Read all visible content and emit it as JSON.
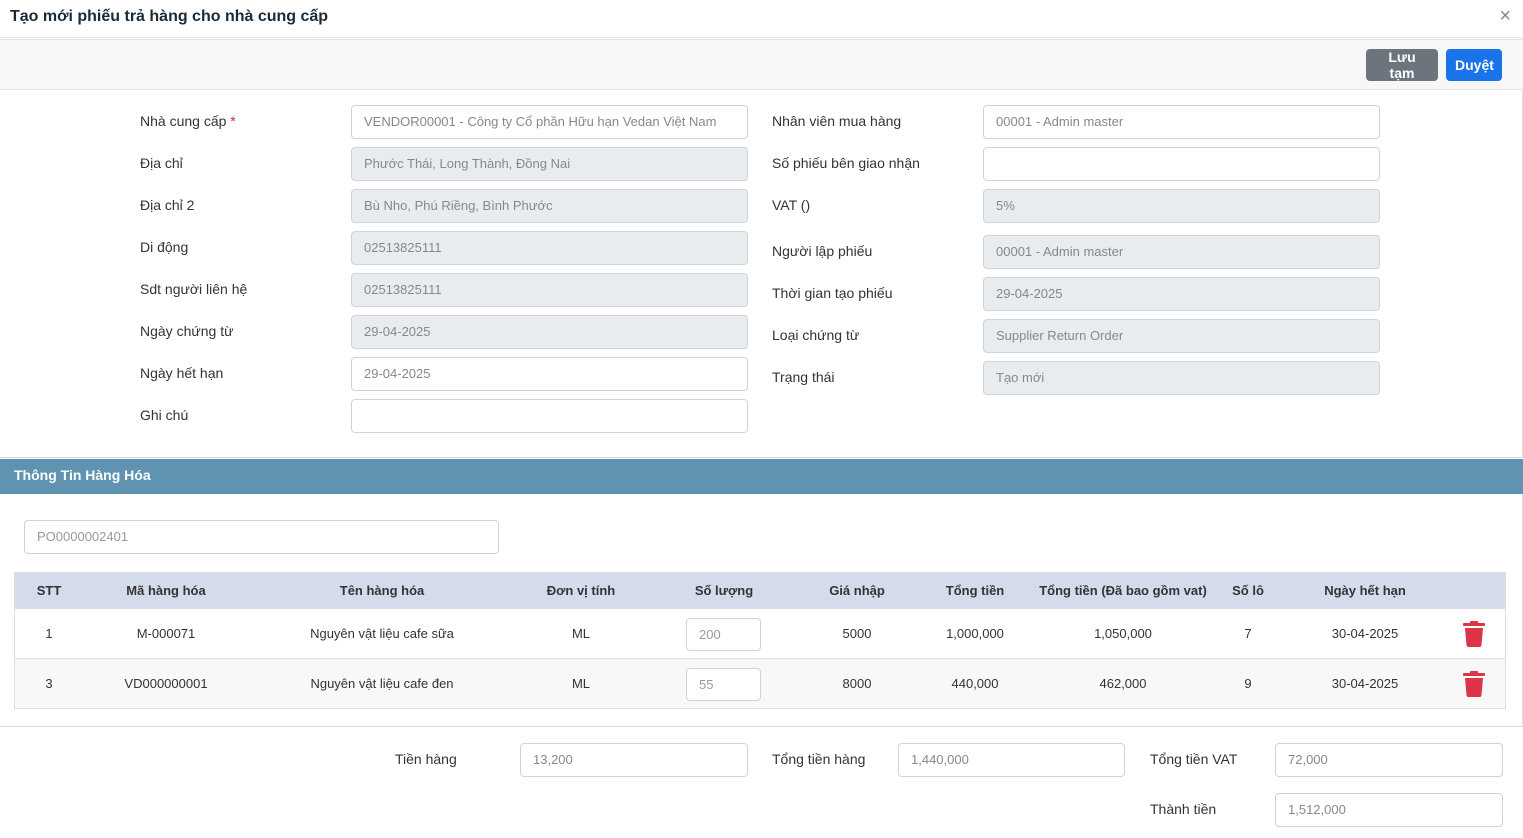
{
  "modal": {
    "title": "Tạo mới phiếu trả hàng cho nhà cung cấp",
    "close_icon": "×"
  },
  "toolbar": {
    "save_draft_label": "Lưu tạm",
    "approve_label": "Duyệt"
  },
  "form": {
    "left": [
      {
        "label": "Nhà cung cấp",
        "required": "*",
        "value": "VENDOR00001 - Công ty Cổ phần Hữu hạn Vedan Việt Nam"
      },
      {
        "label": "Địa chỉ",
        "value": "Phước Thái, Long Thành, Đồng Nai"
      },
      {
        "label": "Địa chỉ 2",
        "value": "Bù Nho, Phú Riềng, Bình Phước"
      },
      {
        "label": "Di động",
        "value": "02513825111"
      },
      {
        "label": "Sdt người liên hệ",
        "value": "02513825111"
      },
      {
        "label": "Ngày chứng từ",
        "value": "29-04-2025"
      },
      {
        "label": "Ngày hết hạn",
        "value": "29-04-2025"
      },
      {
        "label": "Ghi chú",
        "value": ""
      }
    ],
    "right": [
      {
        "label": "Nhân viên mua hàng",
        "value": "00001 - Admin master"
      },
      {
        "label": "Số phiếu bên giao nhận",
        "value": ""
      },
      {
        "label": "VAT ()",
        "value": "5%"
      },
      {
        "label": "Người lập phiếu",
        "value": "00001 - Admin master"
      },
      {
        "label": "Thời gian tạo phiếu",
        "value": "29-04-2025"
      },
      {
        "label": "Loại chứng từ",
        "value": "Supplier Return Order"
      },
      {
        "label": "Trạng thái",
        "value": "Tạo mới"
      }
    ]
  },
  "goods": {
    "section_title": "Thông Tin Hàng Hóa",
    "po_input_placeholder": "PO0000002401",
    "columns": [
      "STT",
      "Mã hàng hóa",
      "Tên hàng hóa",
      "Đơn vị tính",
      "Số lượng",
      "Giá nhập",
      "Tổng tiền",
      "Tổng tiền (Đã bao gồm vat)",
      "Số lô",
      "Ngày hết hạn"
    ],
    "rows": [
      {
        "stt": "1",
        "code": "M-000071",
        "name": "Nguyên vật liệu cafe sữa",
        "unit": "ML",
        "qty": "200",
        "price": "5000",
        "total": "1,000,000",
        "total_vat": "1,050,000",
        "lot": "7",
        "expiry": "30-04-2025"
      },
      {
        "stt": "3",
        "code": "VD000000001",
        "name": "Nguyên vật liệu cafe đen",
        "unit": "ML",
        "qty": "55",
        "price": "8000",
        "total": "440,000",
        "total_vat": "462,000",
        "lot": "9",
        "expiry": "30-04-2025"
      }
    ],
    "delete_icon": "trash-icon",
    "delete_color": "#dc3545"
  },
  "totals": {
    "goods_amount_label": "Tiền hàng",
    "goods_amount_value": "13,200",
    "total_goods_label": "Tổng tiền hàng",
    "total_goods_value": "1,440,000",
    "total_vat_label": "Tổng tiền VAT",
    "total_vat_value": "72,000",
    "grand_total_label": "Thành tiền",
    "grand_total_value": "1,512,000"
  }
}
